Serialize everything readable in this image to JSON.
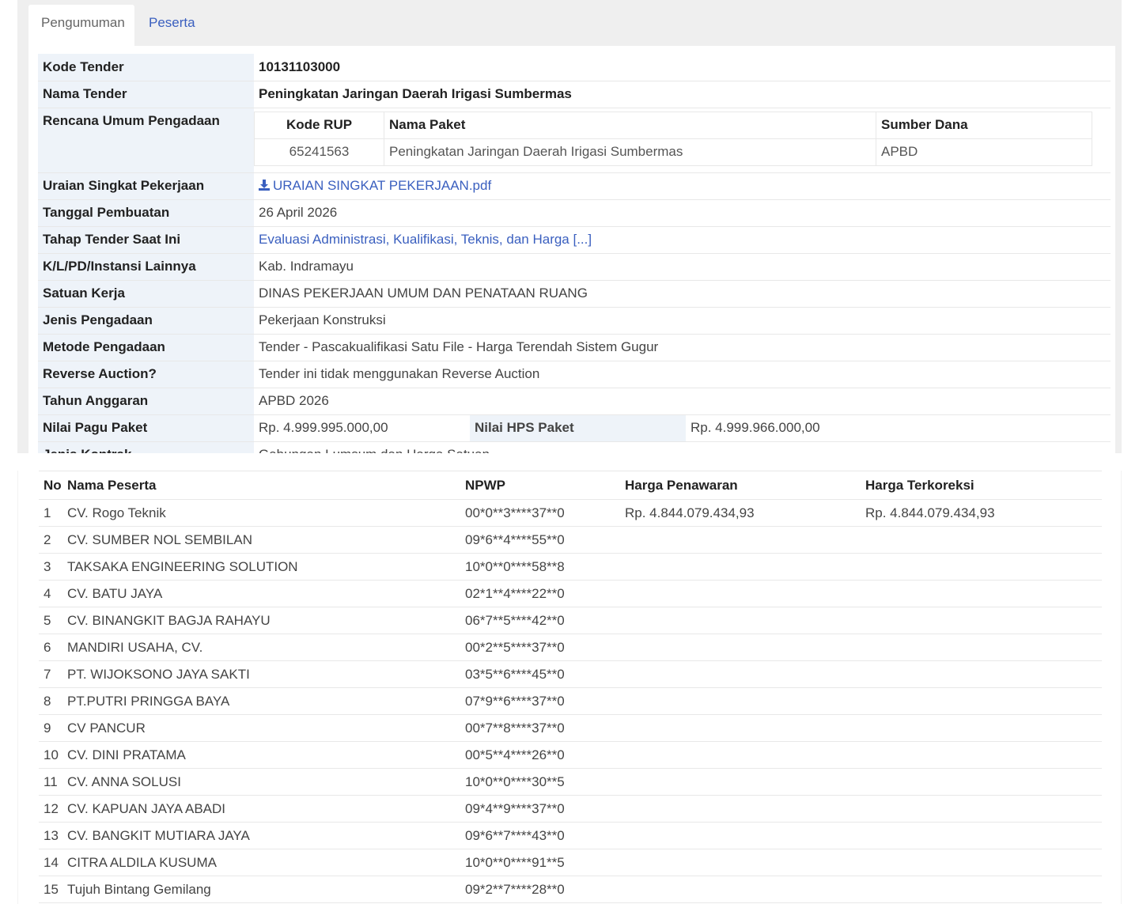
{
  "tabs": [
    "Pengumuman",
    "Peserta"
  ],
  "info": {
    "kode_tender": {
      "label": "Kode Tender",
      "value": "10131103000"
    },
    "nama_tender": {
      "label": "Nama Tender",
      "value": "Peningkatan Jaringan Daerah Irigasi Sumbermas"
    },
    "rup": {
      "label": "Rencana Umum Pengadaan",
      "headers": [
        "Kode RUP",
        "Nama Paket",
        "Sumber Dana"
      ],
      "row": [
        "65241563",
        "Peningkatan Jaringan Daerah Irigasi Sumbermas",
        "APBD"
      ]
    },
    "uraian": {
      "label": "Uraian Singkat Pekerjaan",
      "value": "URAIAN SINGKAT PEKERJAAN.pdf",
      "icon": "download-icon"
    },
    "tanggal": {
      "label": "Tanggal Pembuatan",
      "value": "26 April 2026"
    },
    "tahap": {
      "label": "Tahap Tender Saat Ini",
      "value": "Evaluasi Administrasi, Kualifikasi, Teknis, dan Harga [...]"
    },
    "klpd": {
      "label": "K/L/PD/Instansi Lainnya",
      "value": "Kab. Indramayu"
    },
    "satker": {
      "label": "Satuan Kerja",
      "value": "DINAS PEKERJAAN UMUM DAN PENATAAN RUANG"
    },
    "jenis": {
      "label": "Jenis Pengadaan",
      "value": "Pekerjaan Konstruksi"
    },
    "metode": {
      "label": "Metode Pengadaan",
      "value": "Tender - Pascakualifikasi Satu File - Harga Terendah Sistem Gugur"
    },
    "reverse": {
      "label": "Reverse Auction?",
      "value": "Tender ini tidak menggunakan Reverse Auction"
    },
    "tahun": {
      "label": "Tahun Anggaran",
      "value": "APBD 2026"
    },
    "pagu": {
      "label": "Nilai Pagu Paket",
      "value": "Rp. 4.999.995.000,00"
    },
    "hps": {
      "label": "Nilai HPS Paket",
      "value": "Rp. 4.999.966.000,00"
    },
    "kontrak": {
      "label": "Jenis Kontrak",
      "value": "Gabungan Lumsum dan Harga Satuan"
    }
  },
  "peserta": {
    "headers": [
      "No",
      "Nama Peserta",
      "NPWP",
      "Harga Penawaran",
      "Harga Terkoreksi"
    ],
    "rows": [
      [
        "1",
        "CV. Rogo Teknik",
        "00*0**3****37**0",
        "Rp. 4.844.079.434,93",
        "Rp. 4.844.079.434,93"
      ],
      [
        "2",
        "CV. SUMBER NOL SEMBILAN",
        "09*6**4****55**0",
        "",
        ""
      ],
      [
        "3",
        "TAKSAKA ENGINEERING SOLUTION",
        "10*0**0****58**8",
        "",
        ""
      ],
      [
        "4",
        "CV. BATU JAYA",
        "02*1**4****22**0",
        "",
        ""
      ],
      [
        "5",
        "CV. BINANGKIT BAGJA RAHAYU",
        "06*7**5****42**0",
        "",
        ""
      ],
      [
        "6",
        "MANDIRI USAHA, CV.",
        "00*2**5****37**0",
        "",
        ""
      ],
      [
        "7",
        "PT. WIJOKSONO JAYA SAKTI",
        "03*5**6****45**0",
        "",
        ""
      ],
      [
        "8",
        "PT.PUTRI PRINGGA BAYA",
        "07*9**6****37**0",
        "",
        ""
      ],
      [
        "9",
        "CV PANCUR",
        "00*7**8****37**0",
        "",
        ""
      ],
      [
        "10",
        "CV. DINI PRATAMA",
        "00*5**4****26**0",
        "",
        ""
      ],
      [
        "11",
        "CV. ANNA SOLUSI",
        "10*0**0****30**5",
        "",
        ""
      ],
      [
        "12",
        "CV. KAPUAN JAYA ABADI",
        "09*4**9****37**0",
        "",
        ""
      ],
      [
        "13",
        "CV. BANGKIT MUTIARA JAYA",
        "09*6**7****43**0",
        "",
        ""
      ],
      [
        "14",
        "CITRA ALDILA KUSUMA",
        "10*0**0****91**5",
        "",
        ""
      ],
      [
        "15",
        "Tujuh Bintang Gemilang",
        "09*2**7****28**0",
        "",
        ""
      ]
    ]
  }
}
